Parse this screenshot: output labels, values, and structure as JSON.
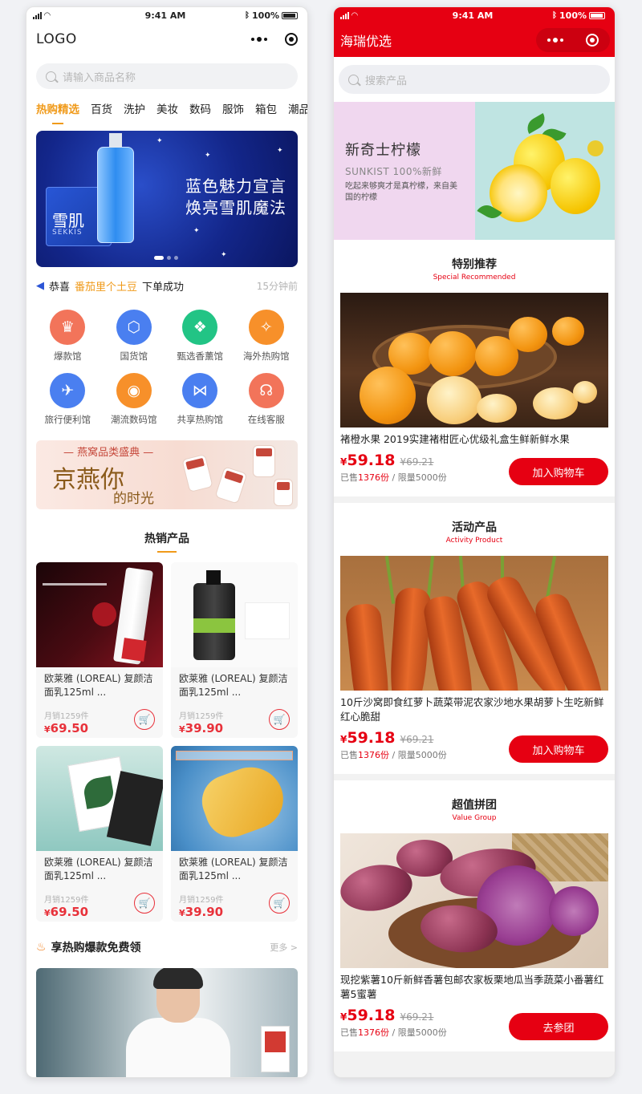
{
  "left": {
    "status": {
      "time": "9:41 AM",
      "battery": "100%"
    },
    "header": {
      "logo": "LOGO"
    },
    "search": {
      "placeholder": "请输入商品名称"
    },
    "tabs": [
      "热购精选",
      "百货",
      "洗护",
      "美妆",
      "数码",
      "服饰",
      "箱包",
      "潮品"
    ],
    "banner": {
      "brand": "雪肌",
      "brand_en": "SEKKIS",
      "line1": "蓝色魅力宣言",
      "line2": "焕亮雪肌魔法"
    },
    "notice": {
      "prefix": "恭喜",
      "user": "番茄里个土豆",
      "action": "下单成功",
      "time": "15分钟前"
    },
    "icons": [
      {
        "label": "爆款馆",
        "icon": "crown-icon",
        "color": "#f2745a",
        "glyph": "♛"
      },
      {
        "label": "国货馆",
        "icon": "cube-icon",
        "color": "#4a7ff0",
        "glyph": "⬡"
      },
      {
        "label": "甄选香薰馆",
        "icon": "perfume-icon",
        "color": "#22c485",
        "glyph": "❖"
      },
      {
        "label": "海外热购馆",
        "icon": "compass-icon",
        "color": "#f7902a",
        "glyph": "✧"
      },
      {
        "label": "旅行便利馆",
        "icon": "airplane-icon",
        "color": "#4a7ff0",
        "glyph": "✈"
      },
      {
        "label": "潮流数码馆",
        "icon": "camera-icon",
        "color": "#f7902a",
        "glyph": "◉"
      },
      {
        "label": "共享热购馆",
        "icon": "share-icon",
        "color": "#4a7ff0",
        "glyph": "⋈"
      },
      {
        "label": "在线客服",
        "icon": "headset-icon",
        "color": "#f2745a",
        "glyph": "☊"
      }
    ],
    "promo": {
      "top": "燕窝品类盛典",
      "main": "京燕你",
      "sub": "的时光"
    },
    "hot_title": "热销产品",
    "products": [
      {
        "name": "欧莱雅 (LOREAL) 复颜洁面乳125ml ...",
        "sold": "月销1259件",
        "currency": "¥",
        "price": "69.50"
      },
      {
        "name": "欧莱雅 (LOREAL) 复颜洁面乳125ml ...",
        "sold": "月销1259件",
        "currency": "¥",
        "price": "39.90"
      },
      {
        "name": "欧莱雅 (LOREAL) 复颜洁面乳125ml ...",
        "sold": "月销1259件",
        "currency": "¥",
        "price": "69.50"
      },
      {
        "name": "欧莱雅 (LOREAL) 复颜洁面乳125ml ...",
        "sold": "月销1259件",
        "currency": "¥",
        "price": "39.90"
      }
    ],
    "free": {
      "title": "享热购爆款免费领",
      "more": "更多 >"
    }
  },
  "right": {
    "status": {
      "time": "9:41 AM",
      "battery": "100%"
    },
    "header": {
      "title": "海瑞优选"
    },
    "search": {
      "placeholder": "搜索产品"
    },
    "banner": {
      "title": "新奇士柠檬",
      "subtitle": "SUNKIST 100%新鲜",
      "desc": "吃起来够爽才是真柠檬，来自美国的柠檬"
    },
    "sections": [
      {
        "title": "特别推荐",
        "title_en": "Special Recommended",
        "name": "褚橙水果  2019实建褚柑匠心优级礼盒生鲜新鲜水果",
        "currency": "¥",
        "price": "59.18",
        "old_price": "¥69.21",
        "sold_prefix": "已售",
        "sold": "1376份",
        "limit": " / 限量5000份",
        "button": "加入购物车"
      },
      {
        "title": "活动产品",
        "title_en": "Activity Product",
        "name": "10斤沙窝即食红萝卜蔬菜带泥农家沙地水果胡萝卜生吃新鲜红心脆甜",
        "currency": "¥",
        "price": "59.18",
        "old_price": "¥69.21",
        "sold_prefix": "已售",
        "sold": "1376份",
        "limit": " / 限量5000份",
        "button": "加入购物车"
      },
      {
        "title": "超值拼团",
        "title_en": "Value Group",
        "name": "现挖紫薯10斤新鲜香薯包邮农家板栗地瓜当季蔬菜小番薯红薯5蜜薯",
        "currency": "¥",
        "price": "59.18",
        "old_price": "¥69.21",
        "sold_prefix": "已售",
        "sold": "1376份",
        "limit": " / 限量5000份",
        "button": "去参团"
      }
    ]
  },
  "colors": {
    "accent_orange": "#f09a1a",
    "brand_red": "#e60012",
    "price_red": "#e8313a"
  }
}
